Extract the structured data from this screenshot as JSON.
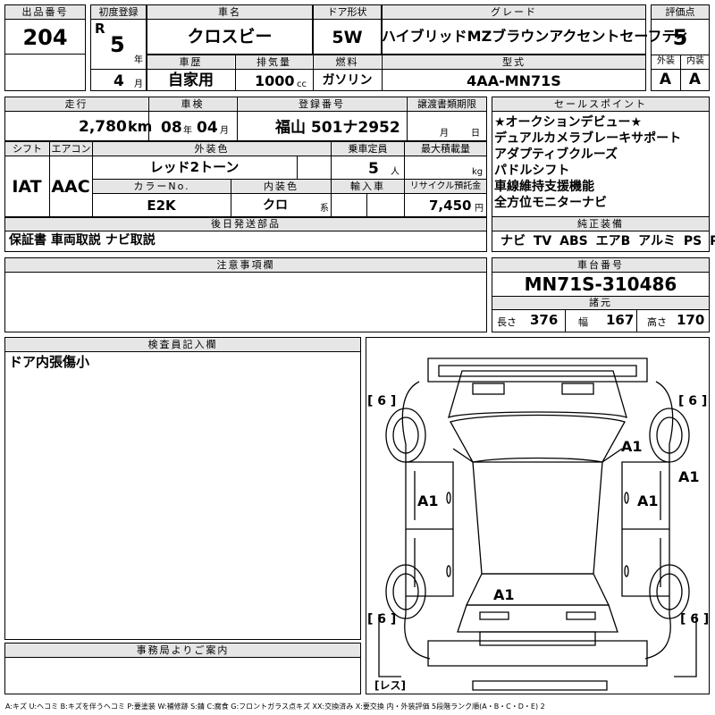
{
  "headers": {
    "lot_no": "出品番号",
    "first_reg": "初度登録",
    "car_name": "車名",
    "door": "ドア形状",
    "grade": "グレード",
    "score": "評価点",
    "history": "車歴",
    "displacement": "排気量",
    "fuel": "燃料",
    "model": "型式",
    "exterior": "外装",
    "interior": "内装",
    "mileage": "走行",
    "inspection": "車検",
    "reg_no": "登録番号",
    "transfer": "譲渡書類期限",
    "selling": "セールスポイント",
    "shift": "シフト",
    "aircon": "エアコン",
    "ext_color": "外装色",
    "capacity": "乗車定員",
    "max_load": "最大積載量",
    "color_no": "カラーNo.",
    "int_color": "内装色",
    "import": "輸入車",
    "recycle": "リサイクル預託金",
    "parts": "後日発送部品",
    "equipment": "純正装備",
    "caution": "注意事項欄",
    "chassis": "車台番号",
    "dims": "諸元",
    "inspector": "検査員記入欄",
    "office": "事務局よりご案内"
  },
  "vehicle": {
    "lot_no": "204",
    "era": "R",
    "year": "5",
    "year_unit": "年",
    "month": "4",
    "month_unit": "月",
    "car_name": "クロスビー",
    "door": "5W",
    "grade": "ハイブリッドMZブラウンアクセントセーフティ",
    "score": "5",
    "history": "自家用",
    "displacement": "1000",
    "cc": "cc",
    "fuel": "ガソリン",
    "model": "4AA-MN71S",
    "ext_score": "A",
    "int_score": "A",
    "mileage": "2,780",
    "km": "km",
    "insp_year": "08",
    "insp_year_unit": "年",
    "insp_month": "04",
    "insp_month_unit": "月",
    "reg_no": "福山 501ナ2952",
    "transfer_month": "月",
    "transfer_day": "日",
    "shift": "IAT",
    "aircon": "AAC",
    "ext_color": "レッド2トーン",
    "capacity": "5",
    "capacity_unit": "人",
    "load_unit": "kg",
    "color_no": "E2K",
    "int_color": "クロ",
    "int_color_unit": "系",
    "recycle": "7,450",
    "yen": "円",
    "parts": "保証書 車両取説 ナビ取説",
    "chassis": "MN71S-310486",
    "len_label": "長さ",
    "length": "376",
    "wid_label": "幅",
    "width": "167",
    "hgt_label": "高さ",
    "height": "170"
  },
  "selling_points": [
    "★オークションデビュー★",
    "デュアルカメラブレーキサポート",
    "アダプティブクルーズ",
    "パドルシフト",
    "車線維持支援機能",
    "全方位モニターナビ"
  ],
  "equipment": "ナビ TV ABS エアB アルミ PS PW",
  "inspector_note": "ドア内張傷小",
  "diagram": {
    "tire_fl": "[ 6 ]",
    "tire_fr": "[ 6 ]",
    "tire_rl": "[ 6 ]",
    "tire_rr": "[ 6 ]",
    "rest": "[レス]",
    "marks": [
      "A1",
      "A1",
      "A1",
      "A1",
      "A1"
    ]
  },
  "legend": "A:キズ U:ヘコミ B:キズを伴うヘコミ P:要塗装 W:補修跡 S:錆 C:腐食 G:フロントガラス点キズ XX:交換済み X:要交換 内・外装評価 5段階ランク順(A・B・C・D・E) 2"
}
